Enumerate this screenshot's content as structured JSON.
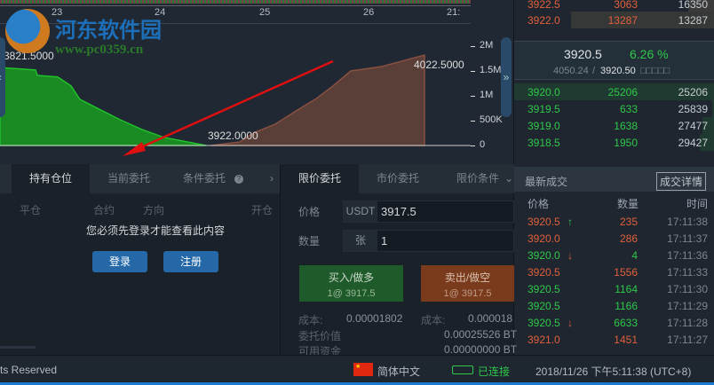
{
  "chart": {
    "x_ticks": [
      "23",
      "24",
      "25",
      "26",
      "21:"
    ],
    "y_ticks": [
      "2M",
      "1.5M",
      "1M",
      "500K",
      "0"
    ],
    "label_left": "3821.5000",
    "label_mid": "3922.0000",
    "label_right": "4022.5000",
    "price_range": [
      3821.5,
      4022.5
    ],
    "depth_range": [
      0,
      2000000
    ],
    "bids": [
      [
        3821.5,
        1570000
      ],
      [
        3838.3,
        1520000
      ],
      [
        3839.2,
        1410000
      ],
      [
        3848.8,
        1380000
      ],
      [
        3855.1,
        1200000
      ],
      [
        3859.3,
        930000
      ],
      [
        3869.9,
        700000
      ],
      [
        3878.3,
        520000
      ],
      [
        3888.8,
        320000
      ],
      [
        3899.3,
        160000
      ],
      [
        3919.1,
        0
      ]
    ],
    "asks": [
      [
        3921.5,
        0
      ],
      [
        3935,
        70000
      ],
      [
        3941.3,
        250000
      ],
      [
        3951.9,
        430000
      ],
      [
        3960.3,
        660000
      ],
      [
        3970.8,
        930000
      ],
      [
        3979.2,
        1200000
      ],
      [
        3987.6,
        1500000
      ],
      [
        4002.3,
        1590000
      ],
      [
        4022.5,
        1820000
      ]
    ],
    "bid_color": "#1a8a22",
    "ask_color": "#5a3e38"
  },
  "watermark": {
    "title": "河东软件园",
    "url": "www.pc0359.cn"
  },
  "orderbook": {
    "asks": [
      {
        "price": "3922.5",
        "amount": "3063",
        "total": "16350"
      },
      {
        "price": "3922.0",
        "amount": "13287",
        "total": "13287"
      }
    ],
    "last_price": "3920.5",
    "change": "6.26 %",
    "index_price": "4050.24",
    "mark_price": "3920.50",
    "mark_suffix": "□□□□□",
    "bids": [
      {
        "price": "3920.0",
        "amount": "25206",
        "total": "25206"
      },
      {
        "price": "3919.5",
        "amount": "633",
        "total": "25839"
      },
      {
        "price": "3919.0",
        "amount": "1638",
        "total": "27477"
      },
      {
        "price": "3918.5",
        "amount": "1950",
        "total": "29427"
      }
    ]
  },
  "trades": {
    "title": "最新成交",
    "detail_button": "成交详情",
    "headers": [
      "价格",
      "数量",
      "时间"
    ],
    "rows": [
      {
        "price": "3920.5",
        "arrow": "↑",
        "amount": "235",
        "time": "17:11:38",
        "side": "red"
      },
      {
        "price": "3920.0",
        "arrow": "",
        "amount": "286",
        "time": "17:11:37",
        "side": "red"
      },
      {
        "price": "3920.0",
        "arrow": "↓",
        "amount": "4",
        "time": "17:11:36",
        "side": "green"
      },
      {
        "price": "3920.5",
        "arrow": "",
        "amount": "1556",
        "time": "17:11:33",
        "side": "red"
      },
      {
        "price": "3920.5",
        "arrow": "",
        "amount": "1164",
        "time": "17:11:30",
        "side": "green"
      },
      {
        "price": "3920.5",
        "arrow": "",
        "amount": "1166",
        "time": "17:11:29",
        "side": "green"
      },
      {
        "price": "3920.5",
        "arrow": "↓",
        "amount": "6633",
        "time": "17:11:28",
        "side": "green"
      },
      {
        "price": "3921.0",
        "arrow": "",
        "amount": "1451",
        "time": "17:11:27",
        "side": "red"
      }
    ]
  },
  "positions": {
    "tabs": [
      "持有仓位",
      "当前委托",
      "条件委托"
    ],
    "columns": [
      "平仓",
      "合约",
      "方向",
      "开仓"
    ],
    "login_message": "您必须先登录才能查看此内容",
    "login_button": "登录",
    "register_button": "注册"
  },
  "order": {
    "tabs": [
      "限价委托",
      "市价委托",
      "限价条件"
    ],
    "price_label": "价格",
    "price_unit": "USDT",
    "price_value": "3917.5",
    "qty_label": "数量",
    "qty_unit": "张",
    "qty_value": "1",
    "buy_label": "买入/做多",
    "buy_sub": "1@ 3917.5",
    "sell_label": "卖出/做空",
    "sell_sub": "1@ 3917.5",
    "cost_label": "成本:",
    "cost_buy": "0.00001802",
    "cost_sell": "0.000018",
    "value_label": "委托价值",
    "value": "0.00025526 BT",
    "funds_label": "可用资金",
    "funds": "0.00000000 BT"
  },
  "status": {
    "copyright": "ts Reserved",
    "language": "简体中文",
    "connection": "已连接",
    "datetime": "2018/11/26 下午5:11:38 (UTC+8)"
  }
}
